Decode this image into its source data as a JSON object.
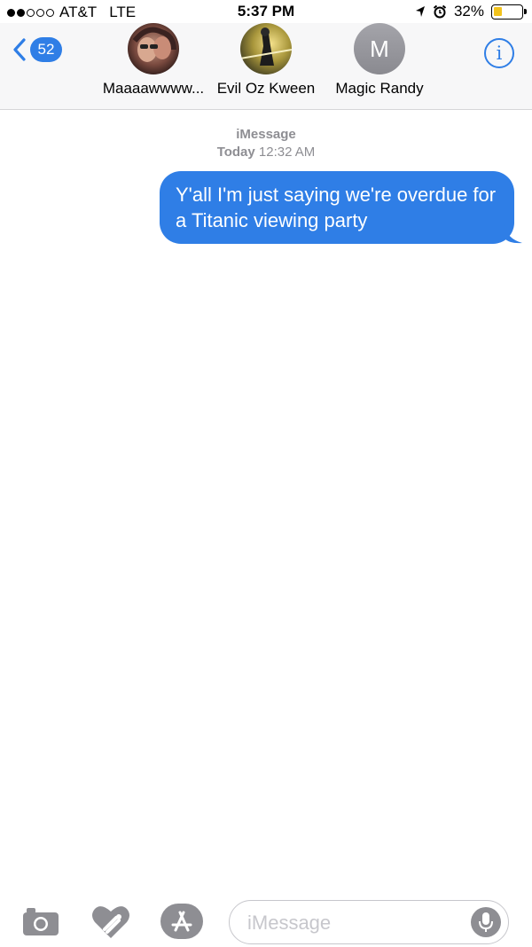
{
  "status_bar": {
    "signal_dots": [
      true,
      true,
      false,
      false,
      false
    ],
    "carrier": "AT&T",
    "network": "LTE",
    "time": "5:37 PM",
    "battery": "32%",
    "battery_level": 0.32,
    "battery_color": "#f2c31d"
  },
  "header": {
    "back_count": "52",
    "contacts": [
      {
        "name": "Maaaawwww...",
        "avatar_type": "photo"
      },
      {
        "name": "Evil Oz Kween",
        "avatar_type": "photo"
      },
      {
        "name": "Magic Randy",
        "initial": "M",
        "avatar_type": "initial"
      }
    ],
    "info_icon": "info-icon"
  },
  "conversation": {
    "service": "iMessage",
    "timestamp_day": "Today",
    "timestamp_time": "12:32 AM",
    "messages": [
      {
        "direction": "outgoing",
        "text": "Y'all I'm just saying we're overdue for a Titanic viewing party"
      }
    ]
  },
  "toolbar": {
    "input_placeholder": "iMessage",
    "icons": [
      "camera-icon",
      "digital-touch-heart-icon",
      "app-store-icon",
      "microphone-icon"
    ]
  },
  "colors": {
    "accent": "#2f7ee6",
    "bubble": "#2f7ee6",
    "gray": "#8e8e93"
  }
}
